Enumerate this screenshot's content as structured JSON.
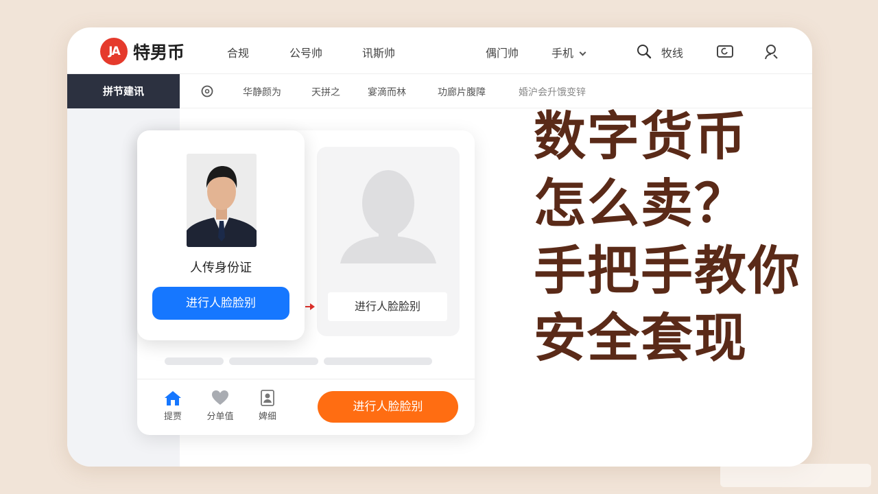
{
  "brand": {
    "logo_mark": "JA",
    "name": "特男币",
    "accent": "#e53a2c"
  },
  "topnav": {
    "links": [
      "合规",
      "公号帅",
      "讯斯帅",
      "偶门帅"
    ],
    "dropdown_label": "手机",
    "search_label": "牧线"
  },
  "subnav": {
    "active": "拼节建讯",
    "items": [
      "华静颜为",
      "天拼之",
      "宴滴而林",
      "功廊片腹障",
      "婚沪会升饿变锌"
    ]
  },
  "idcard": {
    "title": "人传身份证",
    "button": "进行人脸脸别",
    "button_color": "#1677ff"
  },
  "face_panel": {
    "button": "进行人脸脸别"
  },
  "bottom_bar": {
    "items": [
      {
        "label": "提贾",
        "icon": "home-icon"
      },
      {
        "label": "分单值",
        "icon": "heart-icon"
      },
      {
        "label": "婢细",
        "icon": "profile-card-icon"
      }
    ],
    "cta": "进行人脸脸别",
    "cta_color": "#ff6d12"
  },
  "headline": {
    "line1": "数字货币",
    "line2": "怎么卖？",
    "line3": "手把手教你",
    "line4": "安全套现",
    "color": "#5a2a18"
  }
}
